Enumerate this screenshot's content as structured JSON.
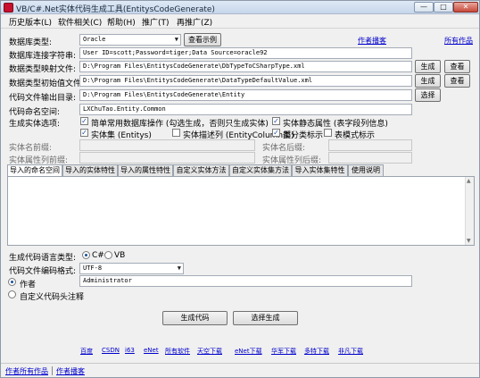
{
  "window": {
    "title": "VB/C#.Net实体代码生成工具(EntitysCodeGenerate)",
    "minimize": "—",
    "maximize": "□",
    "close": "✕"
  },
  "menu": [
    "历史版本(L)",
    "软件相关(C)",
    "帮助(H)",
    "推广(T)",
    "再推广(Z)"
  ],
  "form": {
    "db_type_label": "数据库类型:",
    "db_type_value": "Oracle",
    "view_example_button": "查看示例",
    "author_blog_link": "作者播客",
    "all_works_link": "所有作品",
    "conn_label": "数据库连接字符串:",
    "conn_value": "User ID=scott;Password=tiger;Data Source=oracle92",
    "type_map_label": "数据类型映射文件:",
    "type_map_value": "D:\\Program Files\\EntitysCodeGenerate\\DbTypeToCSharpType.xml",
    "type_init_label": "数据类型初始值文件:",
    "type_init_value": "D:\\Program Files\\EntitysCodeGenerate\\DataTypeDefaultValue.xml",
    "output_dir_label": "代码文件输出目录:",
    "output_dir_value": "D:\\Program Files\\EntitysCodeGenerate\\Entity",
    "generate_button": "生成",
    "view_button": "查看",
    "select_button": "选择",
    "namespace_label": "代码命名空间:",
    "namespace_value": "LXChuTao.Entity.Common",
    "options_label": "生成实体选项:",
    "option_simple_db": "简单常用数据库操作 (勾选生成，否则只生成实体)",
    "option_entity_static": "实体静态属性 (表字段列信息)",
    "option_entity_set": "实体集 (Entitys)",
    "option_entity_desc": "实体描述列 (EntityColumn类)",
    "option_partial": "部分类标示",
    "option_table_mode": "表模式标示",
    "prefix_label": "实体名前缀:",
    "suffix_label": "实体名后缀:",
    "prop_prefix_label": "实体属性列前缀:",
    "prop_suffix_label": "实体属性列后缀:",
    "lang_label": "生成代码语言类型:",
    "lang_cs": "C#",
    "lang_vb": "VB",
    "encoding_label": "代码文件编码格式:",
    "encoding_value": "UTF-8",
    "author_label": "作者",
    "author_value": "Administrator",
    "custom_header_label": "自定义代码头注释",
    "gen_code_button": "生成代码",
    "select_gen_button": "选择生成"
  },
  "tabs": [
    "导入的命名空间",
    "导入的实体特性",
    "导入的属性特性",
    "自定义实体方法",
    "自定义实体集方法",
    "导入实体集特性",
    "使用说明"
  ],
  "footer_links": [
    "百度",
    "CSDN",
    "i63",
    "eNet",
    "所有软件",
    "天空下载",
    "eNet下载",
    "华军下载",
    "多特下载",
    "非凡下载"
  ],
  "status": {
    "all_works": "作者所有作品",
    "blog": "作者播客"
  }
}
